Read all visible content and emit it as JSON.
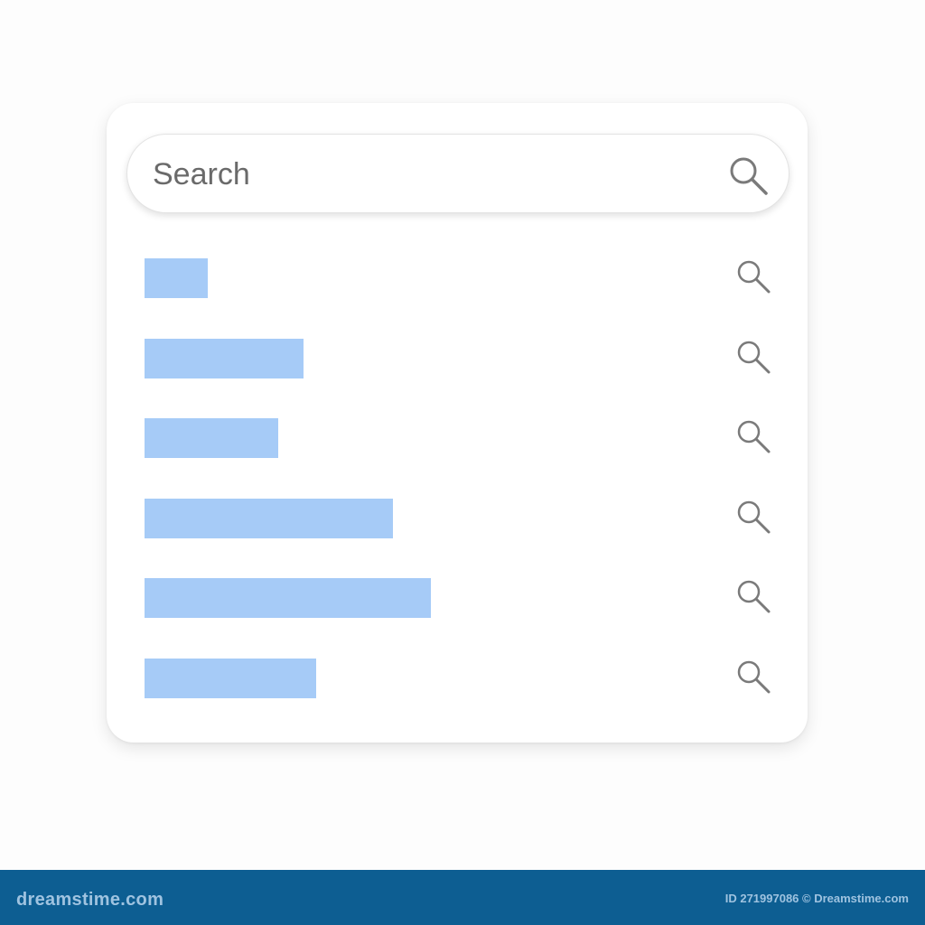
{
  "search": {
    "placeholder": "Search",
    "value": "",
    "icon": "search-icon"
  },
  "suggestions": [
    {
      "fill": 0.1,
      "icon": "search-icon"
    },
    {
      "fill": 0.25,
      "icon": "search-icon"
    },
    {
      "fill": 0.21,
      "icon": "search-icon"
    },
    {
      "fill": 0.39,
      "icon": "search-icon"
    },
    {
      "fill": 0.45,
      "icon": "search-icon"
    },
    {
      "fill": 0.27,
      "icon": "search-icon"
    }
  ],
  "colors": {
    "placeholder_bar": "#a6cbf7",
    "icon_stroke": "#7a7a7a",
    "footer_bg": "#0d5e92"
  },
  "footer": {
    "brand": "dreamstime.com",
    "credit": "ID 271997086 © Dreamstime.com"
  }
}
